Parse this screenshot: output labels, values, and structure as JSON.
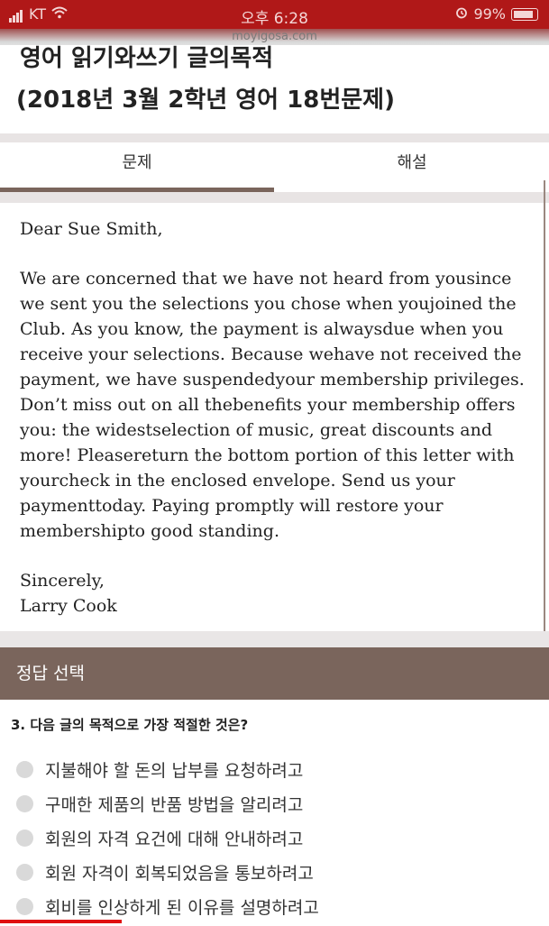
{
  "status_bar": {
    "carrier": "KT",
    "time": "오후 6:28",
    "battery": "99%"
  },
  "domain": "moyigosa.com",
  "title_line1": "영어 읽기와쓰기 글의목적",
  "title_line2": "(2018년 3월 2학년 영어 18번문제)",
  "tabs": [
    {
      "label": "문제"
    },
    {
      "label": "해설"
    }
  ],
  "letter": {
    "greeting": "Dear Sue Smith,",
    "body": "We are concerned that we have not heard from yousince we sent you the selections you chose when youjoined the Club. As you know, the payment is alwaysdue when you receive your selections. Because wehave not received the payment, we have suspendedyour membership privileges. Don’t miss out on all thebenefits your membership offers you: the widestselection of music, great discounts and more! Pleasereturn the bottom portion of this letter with yourcheck in the enclosed envelope. Send us your paymenttoday. Paying promptly will restore your membershipto good standing.",
    "closing": "Sincerely,",
    "signature": "Larry Cook"
  },
  "answer_section": {
    "label": "정답 선택"
  },
  "question": "3. 다음 글의 목적으로 가장 적절한 것은?",
  "options": [
    "지불해야 할 돈의 납부를 요청하려고",
    "구매한 제품의 반품 방법을 알리려고",
    "회원의 자격 요건에 대해 안내하려고",
    "회원 자격이 회복되었음을 통보하려고",
    "회비를 인상하게 된 이유를 설명하려고"
  ],
  "colors": {
    "status_bar": "#b01818",
    "accent": "#7a655c",
    "video_progress": "#e01010"
  }
}
